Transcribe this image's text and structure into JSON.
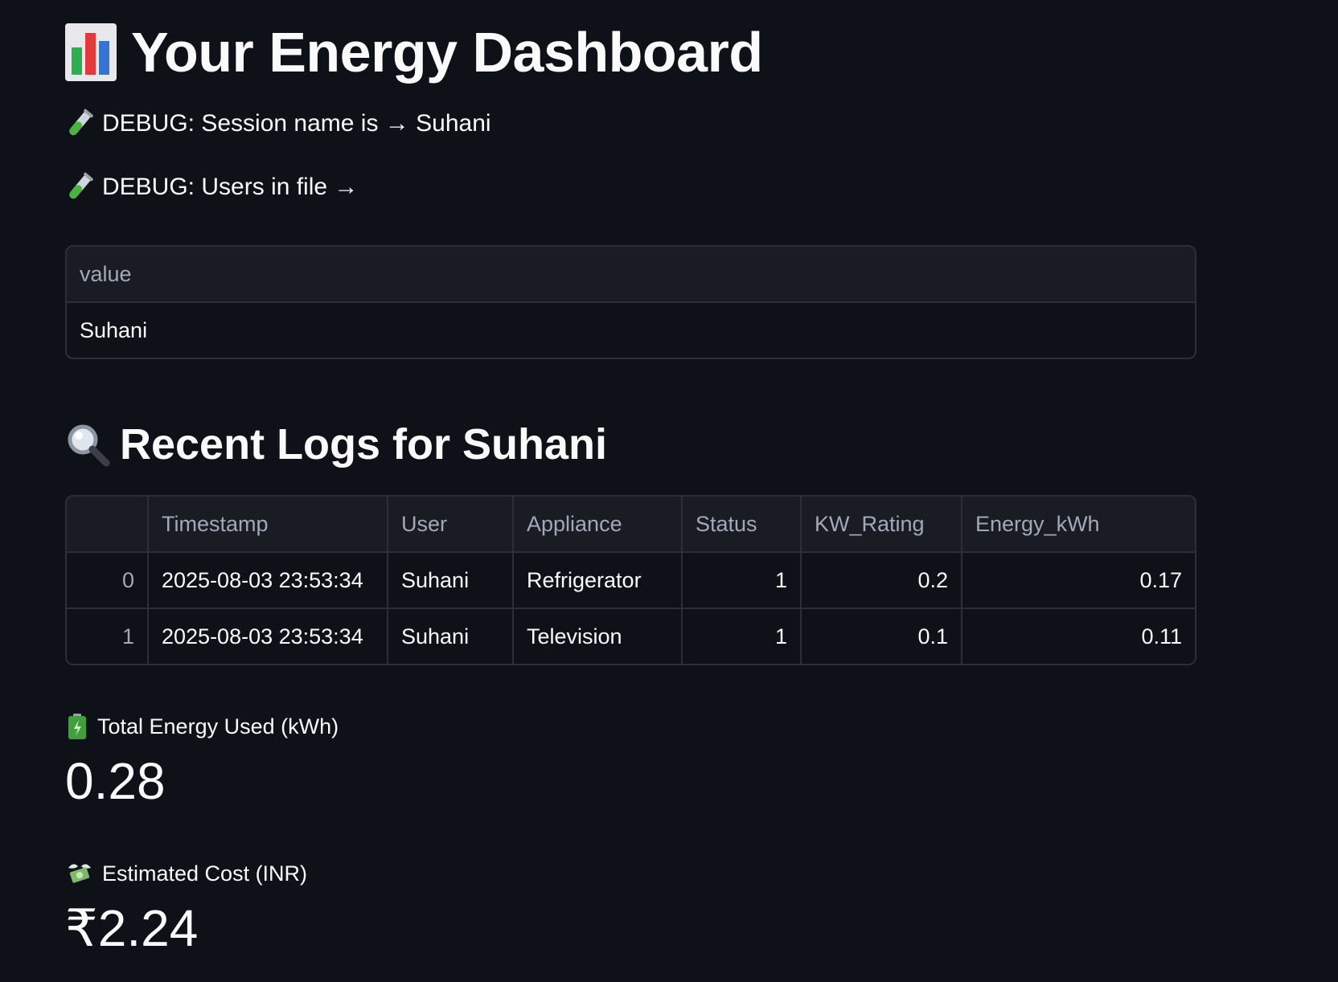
{
  "header": {
    "title": "Your Energy Dashboard",
    "title_icon": "bar-chart-icon"
  },
  "debug": {
    "session_line": "DEBUG: Session name is → Suhani",
    "users_line": "DEBUG: Users in file →",
    "icon": "test-tube-icon"
  },
  "users_table": {
    "header": "value",
    "rows": [
      "Suhani"
    ]
  },
  "logs": {
    "title": "Recent Logs for Suhani",
    "title_icon": "magnifier-icon",
    "columns": [
      "",
      "Timestamp",
      "User",
      "Appliance",
      "Status",
      "KW_Rating",
      "Energy_kWh"
    ],
    "rows": [
      {
        "index": "0",
        "timestamp": "2025-08-03 23:53:34",
        "user": "Suhani",
        "appliance": "Refrigerator",
        "status": "1",
        "kw_rating": "0.2",
        "energy_kwh": "0.17"
      },
      {
        "index": "1",
        "timestamp": "2025-08-03 23:53:34",
        "user": "Suhani",
        "appliance": "Television",
        "status": "1",
        "kw_rating": "0.1",
        "energy_kwh": "0.11"
      }
    ]
  },
  "metrics": {
    "energy": {
      "label": "Total Energy Used (kWh)",
      "value": "0.28",
      "icon": "battery-icon"
    },
    "cost": {
      "label": "Estimated Cost (INR)",
      "value": "₹2.24",
      "icon": "money-wings-icon"
    }
  },
  "colors": {
    "background": "#0e1117",
    "text": "#fafafa",
    "muted": "#a3a8b8",
    "table_header_bg": "#1a1c24",
    "border": "#2b2f38"
  }
}
